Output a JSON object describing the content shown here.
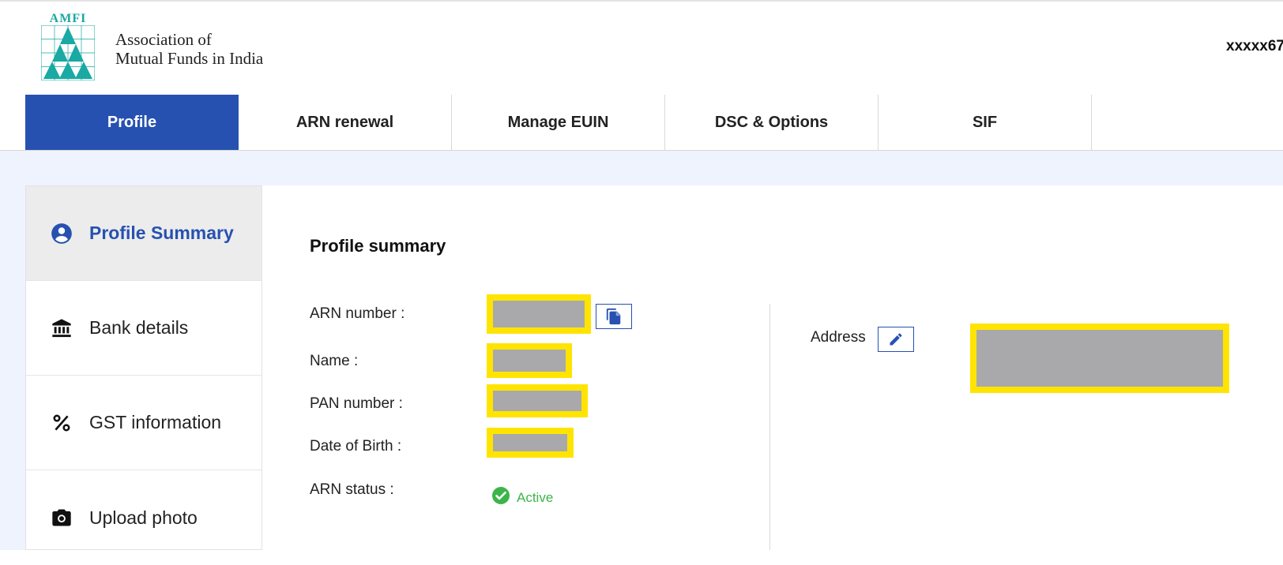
{
  "header": {
    "logo_acronym": "AMFI",
    "org_name_line1": "Association of",
    "org_name_line2": "Mutual Funds in India",
    "user_id": "xxxxx67"
  },
  "tabs": [
    {
      "label": "Profile",
      "active": true
    },
    {
      "label": "ARN renewal",
      "active": false
    },
    {
      "label": "Manage EUIN",
      "active": false
    },
    {
      "label": "DSC & Options",
      "active": false
    },
    {
      "label": "SIF",
      "active": false
    }
  ],
  "sidebar": {
    "items": [
      {
        "label": "Profile Summary",
        "icon": "account-circle-icon",
        "active": true
      },
      {
        "label": "Bank details",
        "icon": "bank-icon",
        "active": false
      },
      {
        "label": "GST information",
        "icon": "percent-icon",
        "active": false
      },
      {
        "label": "Upload photo",
        "icon": "camera-icon",
        "active": false
      }
    ]
  },
  "profile": {
    "title": "Profile summary",
    "fields": {
      "arn_number_label": "ARN number :",
      "name_label": "Name :",
      "pan_label": "PAN number :",
      "dob_label": "Date of Birth :",
      "status_label": "ARN status :"
    },
    "status_value": "Active",
    "address_label": "Address"
  },
  "colors": {
    "brand_blue": "#2751b0",
    "logo_teal": "#1aa9a3",
    "redaction_border": "#ffe400",
    "redaction_fill": "#a9a9ab",
    "status_green": "#3bb54a",
    "band_bg": "#eef3fd"
  }
}
